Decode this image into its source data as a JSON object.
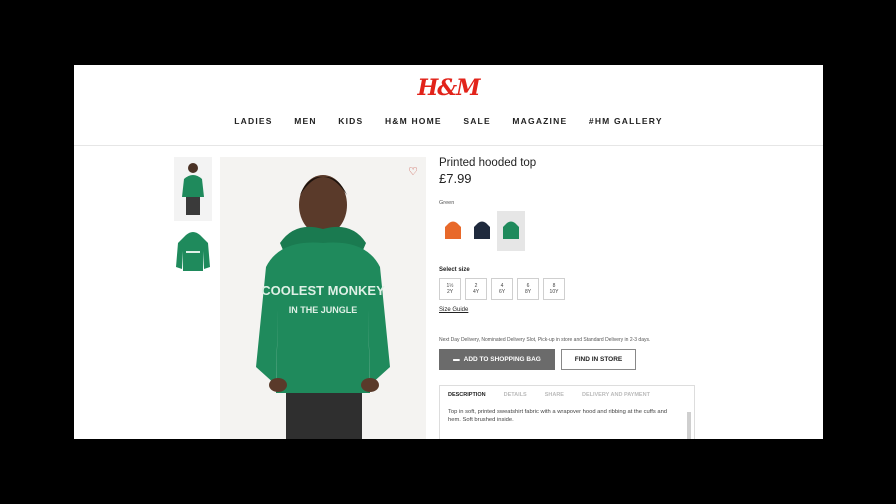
{
  "logo": "H&M",
  "nav": [
    "LADIES",
    "MEN",
    "KIDS",
    "H&M HOME",
    "SALE",
    "MAGAZINE",
    "#HM GALLERY"
  ],
  "product": {
    "name": "Printed hooded top",
    "price": "£7.99",
    "color_label": "Green",
    "hoodie_print_line1": "COOLEST MONKEY",
    "hoodie_print_line2": "IN THE JUNGLE"
  },
  "swatches": [
    {
      "color": "#e8692a",
      "selected": false
    },
    {
      "color": "#1f2a3d",
      "selected": false
    },
    {
      "color": "#1f8a5c",
      "selected": true
    }
  ],
  "size_label": "Select size",
  "sizes": [
    {
      "top": "1½",
      "bottom": "2Y"
    },
    {
      "top": "2",
      "bottom": "4Y"
    },
    {
      "top": "4",
      "bottom": "6Y"
    },
    {
      "top": "6",
      "bottom": "8Y"
    },
    {
      "top": "8",
      "bottom": "10Y"
    }
  ],
  "size_guide": "Size Guide",
  "delivery_text": "Next Day Delivery, Nominated Delivery Slot, Pick-up in store and Standard Delivery in 2-3 days.",
  "buttons": {
    "add": "ADD TO SHOPPING BAG",
    "find": "FIND IN STORE"
  },
  "tabs": [
    "DESCRIPTION",
    "DETAILS",
    "SHARE",
    "DELIVERY AND PAYMENT"
  ],
  "description": "Top in soft, printed sweatshirt fabric with a wrapover hood and ribbing at the cuffs and hem. Soft brushed inside.",
  "colors": {
    "brand": "#e2231a",
    "hoodie": "#1f8a5c"
  }
}
